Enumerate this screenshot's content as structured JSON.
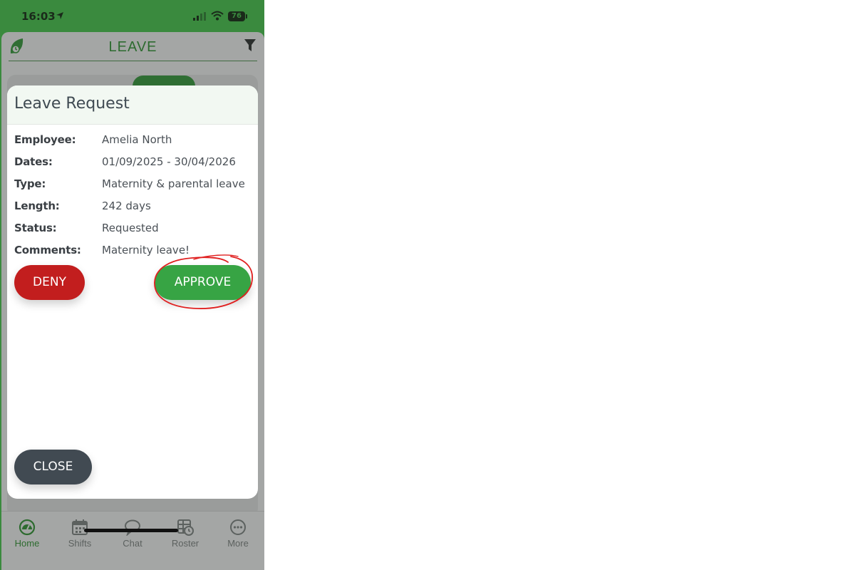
{
  "status_bar": {
    "time": "16:03",
    "battery": "76"
  },
  "header": {
    "title": "LEAVE"
  },
  "modal": {
    "title": "Leave Request",
    "details": [
      {
        "label": "Employee:",
        "value": "Amelia North"
      },
      {
        "label": "Dates:",
        "value": "01/09/2025 - 30/04/2026"
      },
      {
        "label": "Type:",
        "value": "Maternity & parental leave"
      },
      {
        "label": "Length:",
        "value": "242 days"
      },
      {
        "label": "Status:",
        "value": "Requested"
      },
      {
        "label": "Comments:",
        "value": "Maternity leave!"
      }
    ],
    "deny_label": "DENY",
    "approve_label": "APPROVE",
    "close_label": "CLOSE"
  },
  "bottom_nav": {
    "items": [
      {
        "label": "Home",
        "icon": "dashboard-icon",
        "active": true
      },
      {
        "label": "Shifts",
        "icon": "calendar-icon",
        "active": false
      },
      {
        "label": "Chat",
        "icon": "chat-bubble-icon",
        "active": false
      },
      {
        "label": "Roster",
        "icon": "roster-icon",
        "active": false
      },
      {
        "label": "More",
        "icon": "more-icon",
        "active": false
      }
    ]
  },
  "colors": {
    "brand_green": "#3a8a3e",
    "deny_red": "#c21e1e",
    "approve_green": "#37a444",
    "close_dark": "#414a52",
    "annotation_red": "#e02020"
  }
}
